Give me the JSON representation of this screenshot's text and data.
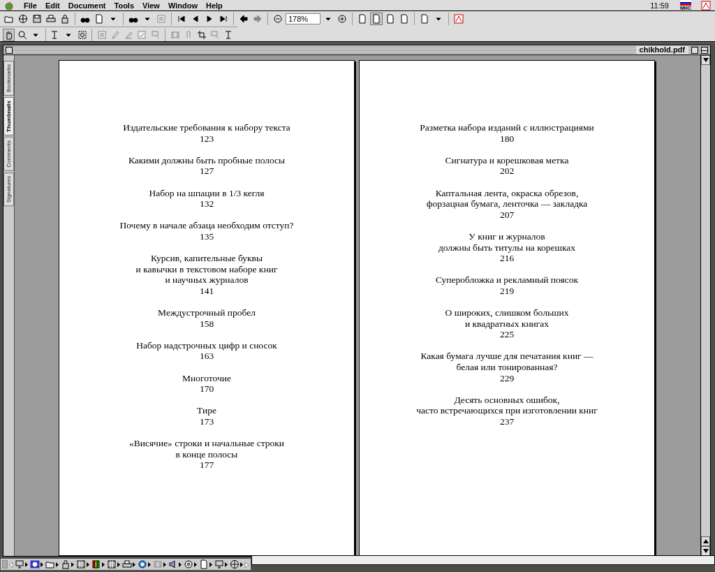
{
  "menu_bar": {
    "menus": [
      "File",
      "Edit",
      "Document",
      "Tools",
      "View",
      "Window",
      "Help"
    ],
    "clock": "11:59",
    "keyboard_layout": "MHC"
  },
  "toolbar": {
    "zoom_value": "178%",
    "page_layouts": [
      {
        "selected": false
      },
      {
        "selected": true
      },
      {
        "selected": false
      },
      {
        "selected": false
      }
    ],
    "tools": [
      {
        "selected": true
      },
      {
        "selected": false
      }
    ]
  },
  "window": {
    "title": "chikhold.pdf"
  },
  "side_tabs": [
    {
      "label": "Bookmarks",
      "selected": false
    },
    {
      "label": "Thumbnails",
      "selected": true
    },
    {
      "label": "Comments",
      "selected": false
    },
    {
      "label": "Signatures",
      "selected": false
    }
  ],
  "pages": [
    {
      "entries": [
        {
          "lines": [
            "Издательские требования к набору текста"
          ],
          "page": "123"
        },
        {
          "lines": [
            "Какими должны быть пробные полосы"
          ],
          "page": "127"
        },
        {
          "lines": [
            "Набор на шпации в 1/3 кегля"
          ],
          "page": "132"
        },
        {
          "lines": [
            "Почему в начале абзаца необходим отступ?"
          ],
          "page": "135"
        },
        {
          "lines": [
            "Курсив, капительные буквы",
            "и кавычки в текстовом наборе книг",
            "и научных журналов"
          ],
          "page": "141"
        },
        {
          "lines": [
            "Междустрочный пробел"
          ],
          "page": "158"
        },
        {
          "lines": [
            "Набор надстрочных цифр и сносок"
          ],
          "page": "163"
        },
        {
          "lines": [
            "Многоточие"
          ],
          "page": "170"
        },
        {
          "lines": [
            "Тире"
          ],
          "page": "173"
        },
        {
          "lines": [
            "«Висячие» строки и начальные строки",
            "в конце полосы"
          ],
          "page": "177"
        }
      ]
    },
    {
      "entries": [
        {
          "lines": [
            "Разметка набора изданий с иллюстрациями"
          ],
          "page": "180"
        },
        {
          "lines": [
            "Сигнатура и корешковая метка"
          ],
          "page": "202"
        },
        {
          "lines": [
            "Каптальная лента, окраска обрезов,",
            "форзацная бумага, ленточка — закладка"
          ],
          "page": "207"
        },
        {
          "lines": [
            "У книг и журналов",
            "должны быть титулы на корешках"
          ],
          "page": "216"
        },
        {
          "lines": [
            "Суперобложка и рекламный поясок"
          ],
          "page": "219"
        },
        {
          "lines": [
            "О широких, слишком больших",
            "и квадратных книгах"
          ],
          "page": "225"
        },
        {
          "lines": [
            "Какая бумага лучше для печатания книг —",
            "белая или тонированная?"
          ],
          "page": "229"
        },
        {
          "lines": [
            "Десять основных ошибок,",
            "часто встречающихся при изготовлении книг"
          ],
          "page": "237"
        }
      ]
    }
  ]
}
